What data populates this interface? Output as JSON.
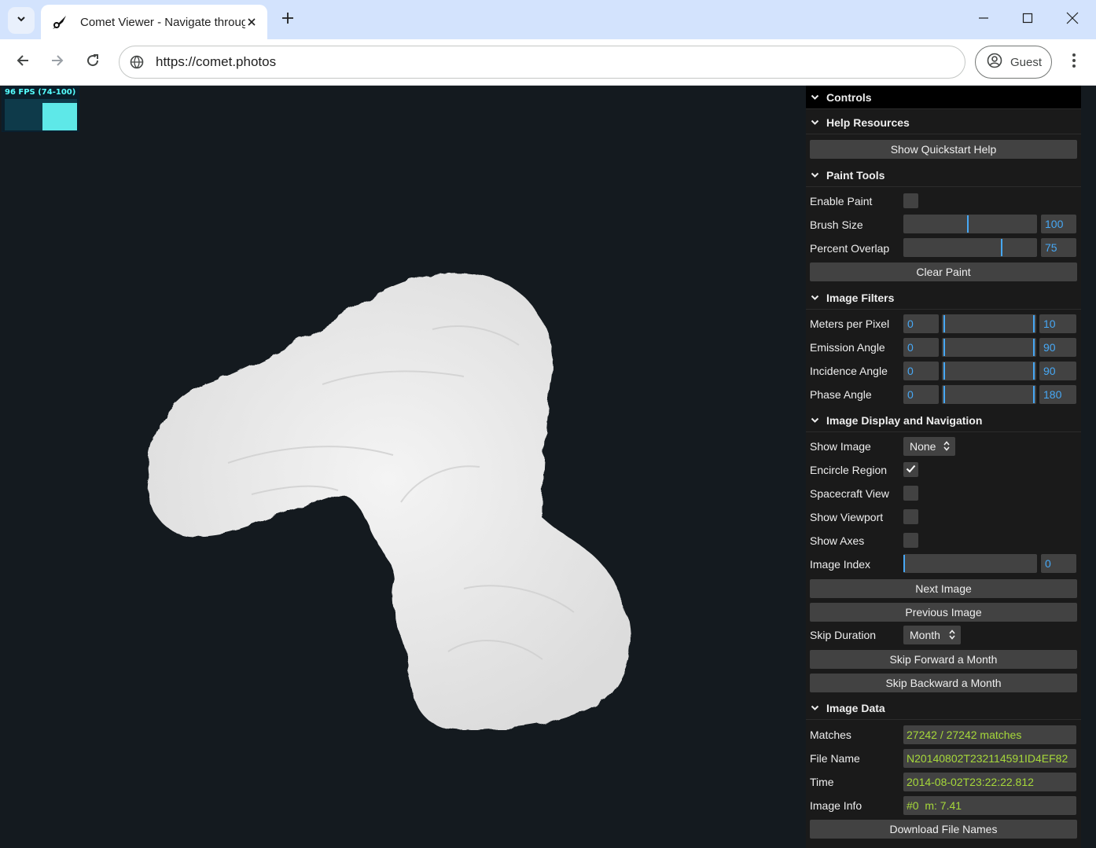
{
  "browser": {
    "tab_title": "Comet Viewer - Navigate through",
    "url": "https://comet.photos",
    "profile_label": "Guest",
    "icons": {
      "tab_dropdown": "chevron-down-icon",
      "favicon": "comet-icon",
      "tab_close": "close-icon",
      "new_tab": "plus-icon",
      "minimize": "minimize-icon",
      "maximize": "maximize-icon",
      "close_window": "close-icon",
      "back": "arrow-left-icon",
      "forward": "arrow-right-icon",
      "reload": "reload-icon",
      "site_info": "globe-icon",
      "profile": "account-circle-icon",
      "menu": "more-vert-icon"
    }
  },
  "stats": {
    "fps_label": "96 FPS (74-100)",
    "fps_value": 96,
    "fps_min": 74,
    "fps_max": 100
  },
  "controls": {
    "root_title": "Controls",
    "help": {
      "title": "Help Resources",
      "quickstart_label": "Show Quickstart Help"
    },
    "paint": {
      "title": "Paint Tools",
      "enable_label": "Enable Paint",
      "enable_checked": false,
      "brush_label": "Brush Size",
      "brush_value": "100",
      "brush_fraction": 0.48,
      "overlap_label": "Percent Overlap",
      "overlap_value": "75",
      "overlap_fraction": 0.74,
      "clear_label": "Clear Paint"
    },
    "filters": {
      "title": "Image Filters",
      "rows": [
        {
          "label": "Meters per Pixel",
          "min": "0",
          "max": "10"
        },
        {
          "label": "Emission Angle",
          "min": "0",
          "max": "90"
        },
        {
          "label": "Incidence Angle",
          "min": "0",
          "max": "90"
        },
        {
          "label": "Phase Angle",
          "min": "0",
          "max": "180"
        }
      ]
    },
    "display": {
      "title": "Image Display and Navigation",
      "show_image_label": "Show Image",
      "show_image_value": "None",
      "encircle_label": "Encircle Region",
      "encircle_checked": true,
      "spacecraft_label": "Spacecraft View",
      "spacecraft_checked": false,
      "viewport_label": "Show Viewport",
      "viewport_checked": false,
      "axes_label": "Show Axes",
      "axes_checked": false,
      "index_label": "Image Index",
      "index_value": "0",
      "index_fraction": 0.0,
      "next_label": "Next Image",
      "prev_label": "Previous Image",
      "skip_label": "Skip Duration",
      "skip_value": "Month",
      "skip_forward_label": "Skip Forward a Month",
      "skip_backward_label": "Skip Backward a Month"
    },
    "data": {
      "title": "Image Data",
      "matches_label": "Matches",
      "matches_value": "27242 / 27242 matches",
      "filename_label": "File Name",
      "filename_value": "N20140802T232114591ID4EF82",
      "time_label": "Time",
      "time_value": "2014-08-02T23:22:22.812",
      "info_label": "Image Info",
      "info_value": "#0  m: 7.41",
      "download_label": "Download File Names"
    }
  },
  "colors": {
    "accent": "#47a8f5",
    "data_text": "#a6d83a",
    "fps_color": "#5ee8e8",
    "viewport_bg": "#141a1f",
    "panel_bg": "#1a1a1a"
  }
}
